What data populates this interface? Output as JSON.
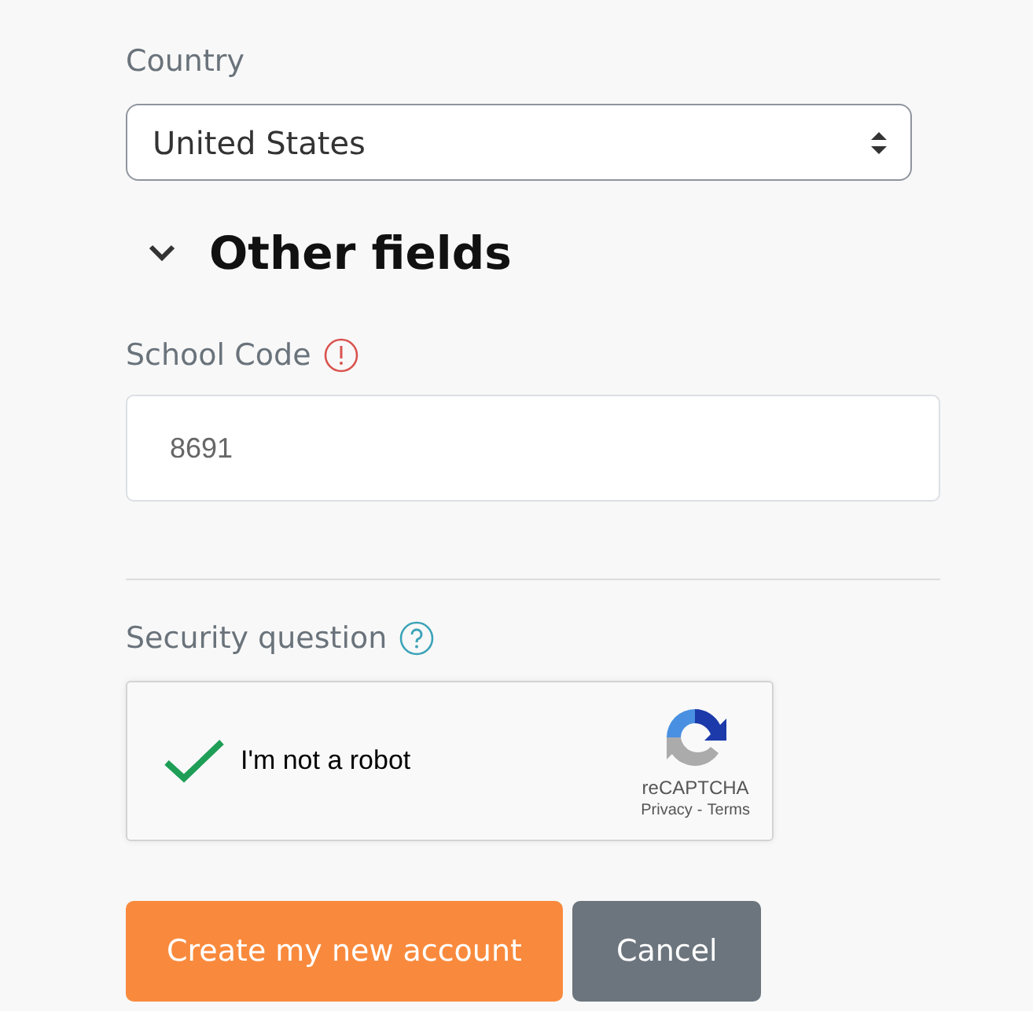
{
  "country": {
    "label": "Country",
    "value": "United States"
  },
  "section": {
    "title": "Other fields",
    "expanded": true
  },
  "school_code": {
    "label": "School Code",
    "value": "8691",
    "warning": true
  },
  "security": {
    "label": "Security question",
    "help": true
  },
  "captcha": {
    "checked": true,
    "label": "I'm not a robot",
    "brand": "reCAPTCHA",
    "privacy": "Privacy",
    "separator": "-",
    "terms": "Terms"
  },
  "buttons": [
    {
      "label": "Create my new account",
      "kind": "primary"
    },
    {
      "label": "Cancel",
      "kind": "secondary"
    }
  ]
}
